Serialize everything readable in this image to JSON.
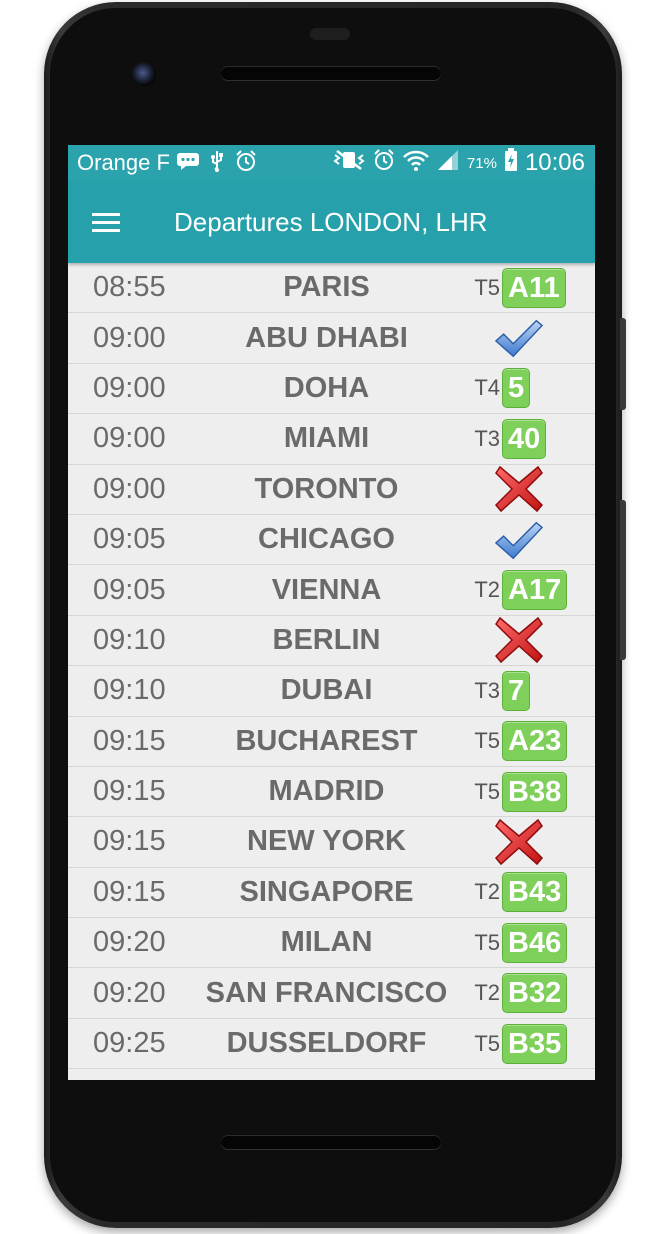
{
  "status_bar": {
    "carrier": "Orange F",
    "battery_percent": "71%",
    "time": "10:06"
  },
  "app_bar": {
    "title": "Departures LONDON, LHR"
  },
  "departures": [
    {
      "time": "08:55",
      "city": "PARIS",
      "terminal": "T5",
      "gate": "A11",
      "status": "gate"
    },
    {
      "time": "09:00",
      "city": "ABU DHABI",
      "terminal": "",
      "gate": "",
      "status": "departed"
    },
    {
      "time": "09:00",
      "city": "DOHA",
      "terminal": "T4",
      "gate": "5",
      "status": "gate"
    },
    {
      "time": "09:00",
      "city": "MIAMI",
      "terminal": "T3",
      "gate": "40",
      "status": "gate"
    },
    {
      "time": "09:00",
      "city": "TORONTO",
      "terminal": "",
      "gate": "",
      "status": "cancelled"
    },
    {
      "time": "09:05",
      "city": "CHICAGO",
      "terminal": "",
      "gate": "",
      "status": "departed"
    },
    {
      "time": "09:05",
      "city": "VIENNA",
      "terminal": "T2",
      "gate": "A17",
      "status": "gate"
    },
    {
      "time": "09:10",
      "city": "BERLIN",
      "terminal": "",
      "gate": "",
      "status": "cancelled"
    },
    {
      "time": "09:10",
      "city": "DUBAI",
      "terminal": "T3",
      "gate": "7",
      "status": "gate"
    },
    {
      "time": "09:15",
      "city": "BUCHAREST",
      "terminal": "T5",
      "gate": "A23",
      "status": "gate"
    },
    {
      "time": "09:15",
      "city": "MADRID",
      "terminal": "T5",
      "gate": "B38",
      "status": "gate"
    },
    {
      "time": "09:15",
      "city": "NEW YORK",
      "terminal": "",
      "gate": "",
      "status": "cancelled"
    },
    {
      "time": "09:15",
      "city": "SINGAPORE",
      "terminal": "T2",
      "gate": "B43",
      "status": "gate"
    },
    {
      "time": "09:20",
      "city": "MILAN",
      "terminal": "T5",
      "gate": "B46",
      "status": "gate"
    },
    {
      "time": "09:20",
      "city": "SAN FRANCISCO",
      "terminal": "T2",
      "gate": "B32",
      "status": "gate"
    },
    {
      "time": "09:25",
      "city": "DUSSELDORF",
      "terminal": "T5",
      "gate": "B35",
      "status": "gate"
    }
  ],
  "icons": {
    "departed": "checkmark-icon",
    "cancelled": "red-cross-icon"
  },
  "colors": {
    "app_bar": "#26a1ab",
    "gate_badge": "#7ed05a",
    "cancelled": "#e32626",
    "departed": "#4a84d6"
  }
}
